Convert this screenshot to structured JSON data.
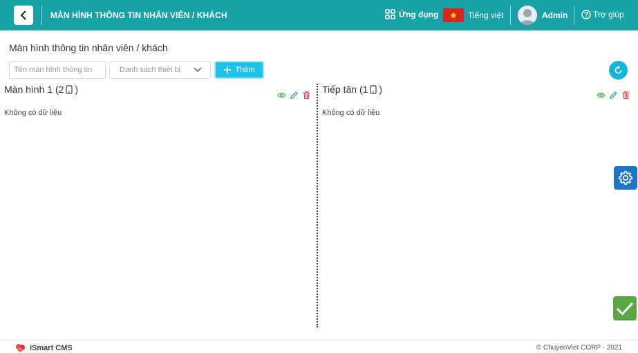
{
  "header": {
    "title": "MÀN HÌNH THÔNG TIN NHÂN VIÊN / KHÁCH",
    "apps_label": "Ứng dụng",
    "language_label": "Tiếng việt",
    "user_label": "Admin",
    "help_label": "Trợ giúp",
    "bg_color": "#16a2a8"
  },
  "page": {
    "title": "Màn hình thông tin nhân viên / khách"
  },
  "toolbar": {
    "name_input": {
      "placeholder": "Tên màn hình thông tin",
      "value": ""
    },
    "device_select": {
      "placeholder": "Danh sách thiết bị"
    },
    "add_label": "Thêm"
  },
  "columns": [
    {
      "title": "Màn hình 1 (2",
      "suffix": ")",
      "empty_text": "Không có dữ liệu"
    },
    {
      "title": "Tiếp tân (1",
      "suffix": ")",
      "empty_text": "Không có dữ liệu"
    }
  ],
  "footer": {
    "brand": "iSmart CMS",
    "copyright": "© ChuyenViet CORP - 2021"
  },
  "colors": {
    "accent": "#1fc1e8",
    "view_icon": "#4caf50",
    "edit_icon": "#2d8ccf",
    "delete_icon": "#e53935",
    "settings_button": "#1d75c7",
    "confirm_button": "#5aa544"
  }
}
